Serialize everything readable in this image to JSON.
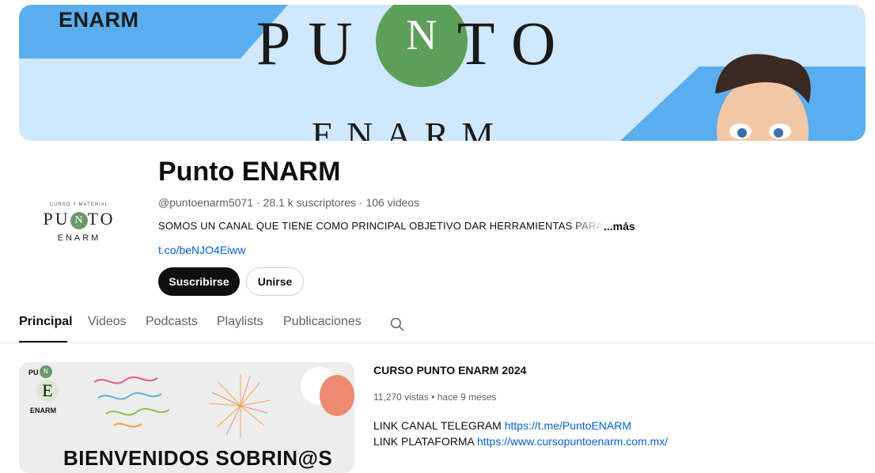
{
  "banner": {
    "brand": "ENARM",
    "title_left": "PU",
    "title_n": "N",
    "title_right": "TO",
    "subtitle": "ENARM"
  },
  "avatar": {
    "top_text": "CURSO Y MATERIAL",
    "main_left": "PU",
    "main_n": "N",
    "main_right": "TO",
    "bottom_text": "ENARM"
  },
  "channel": {
    "name": "Punto ENARM",
    "handle": "@puntoenarm5071",
    "subscribers": "28.1 k suscriptores",
    "videos": "106 videos",
    "separator": "·",
    "description": "SOMOS UN CANAL QUE TIENE COMO PRINCIPAL OBJETIVO DAR HERRAMIENTAS PARA L",
    "more": "...más",
    "link": "t.co/beNJO4Eiww",
    "subscribe_label": "Suscribirse",
    "join_label": "Unirse"
  },
  "tabs": [
    {
      "label": "Principal",
      "active": true
    },
    {
      "label": "Videos",
      "active": false
    },
    {
      "label": "Podcasts",
      "active": false
    },
    {
      "label": "Playlists",
      "active": false
    },
    {
      "label": "Publicaciones",
      "active": false
    }
  ],
  "search_icon": "search-icon",
  "featured": {
    "thumb_logo_top": "PU TO",
    "thumb_logo_n": "N",
    "thumb_logo_e": "E",
    "thumb_logo_bottom": "ENARM",
    "thumb_title": "BIENVENIDOS SOBRIN@S",
    "title": "CURSO PUNTO ENARM 2024",
    "views": "11,270 vistas",
    "age": "hace 9 meses",
    "line1_label": "LINK CANAL TELEGRAM",
    "line1_url": "https://t.me/PuntoENARM",
    "line2_label": "LINK PLATAFORMA",
    "line2_url": "https://www.cursopuntoenarm.com.mx/"
  },
  "colors": {
    "banner_bg": "#cfe8fb",
    "banner_blue": "#5aaef0",
    "green": "#5d9f58",
    "link": "#065fd4",
    "button_dark": "#0f0f0f"
  }
}
